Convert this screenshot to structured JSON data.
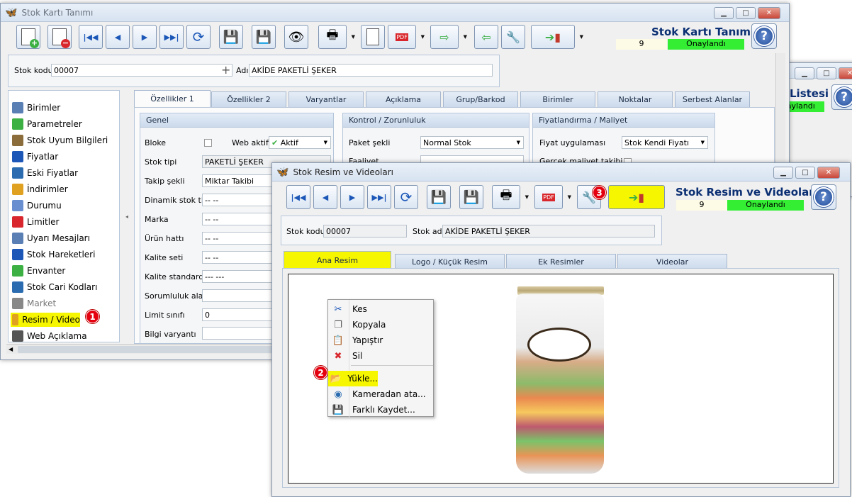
{
  "main_window": {
    "title": "Stok Kartı Tanımı",
    "header_title": "Stok Kartı Tanımı",
    "record_no": "9",
    "status": "Onaylandı",
    "stok_kodu_label": "Stok kodu",
    "stok_kodu": "00007",
    "adi_label": "Adı",
    "adi": "AKİDE PAKETLİ ŞEKER",
    "nav": [
      {
        "label": "Birimler",
        "icon": "units-icon"
      },
      {
        "label": "Parametreler",
        "icon": "parameters-icon"
      },
      {
        "label": "Stok Uyum Bilgileri",
        "icon": "harmony-icon"
      },
      {
        "label": "Fiyatlar",
        "icon": "prices-icon"
      },
      {
        "label": "Eski Fiyatlar",
        "icon": "old-prices-icon"
      },
      {
        "label": "İndirimler",
        "icon": "discount-icon"
      },
      {
        "label": "Durumu",
        "icon": "status-icon"
      },
      {
        "label": "Limitler",
        "icon": "limits-icon"
      },
      {
        "label": "Uyarı Mesajları",
        "icon": "warning-messages-icon"
      },
      {
        "label": "Stok Hareketleri",
        "icon": "stock-movements-icon"
      },
      {
        "label": "Envanter",
        "icon": "inventory-icon"
      },
      {
        "label": "Stok Cari Kodları",
        "icon": "account-codes-icon"
      },
      {
        "label": "Market",
        "icon": "market-icon"
      },
      {
        "label": "Resim / Video",
        "icon": "image-video-icon"
      },
      {
        "label": "Web Açıklama",
        "icon": "web-description-icon"
      }
    ],
    "tabs": [
      "Özellikler 1",
      "Özellikler 2",
      "Varyantlar",
      "Açıklama",
      "Grup/Barkod",
      "Birimler",
      "Noktalar",
      "Serbest Alanlar"
    ],
    "genel": {
      "title": "Genel",
      "bloke": "Bloke",
      "web_aktif": "Web aktif",
      "web_aktif_value": "Aktif",
      "stok_tipi": "Stok tipi",
      "stok_tipi_value": "PAKETLİ ŞEKER",
      "takip_sekli": "Takip şekli",
      "takip_sekli_value": "Miktar Takibi",
      "dinamik": "Dinamik stok tipi",
      "dinamik_value": "-- --",
      "marka": "Marka",
      "marka_value": "-- --",
      "urun_hatti": "Ürün hattı",
      "urun_hatti_value": "-- --",
      "kalite_seti": "Kalite seti",
      "kalite_seti_value": "-- --",
      "kalite_std": "Kalite standardı",
      "kalite_std_value": "--- ---",
      "sorumluluk": "Sorumluluk alanı",
      "limit": "Limit sınıfı",
      "limit_value": "0",
      "bilgi": "Bilgi varyantı"
    },
    "kontrol": {
      "title": "Kontrol / Zorunluluk",
      "paket": "Paket şekli",
      "paket_value": "Normal Stok",
      "faaliyet": "Faaliyet"
    },
    "fiyat": {
      "title": "Fiyatlandırma / Maliyet",
      "uygulama": "Fiyat uygulaması",
      "uygulama_value": "Stok Kendi Fiyatı",
      "gercek": "Gerçek maliyet takibi"
    }
  },
  "bg_window": {
    "title": "Listesi",
    "status": "Onaylandı"
  },
  "image_window": {
    "title": "Stok Resim ve Videoları",
    "header_title": "Stok Resim ve Videoları",
    "record_no": "9",
    "status": "Onaylandı",
    "stok_kodu_label": "Stok kodu",
    "stok_kodu": "00007",
    "stok_adi_label": "Stok adı",
    "stok_adi": "AKİDE PAKETLİ ŞEKER",
    "tabs": [
      "Ana Resim",
      "Logo / Küçük Resim",
      "Ek Resimler",
      "Videolar"
    ],
    "context_menu": [
      {
        "label": "Kes",
        "icon": "scissors-icon"
      },
      {
        "label": "Kopyala",
        "icon": "copy-icon"
      },
      {
        "label": "Yapıştır",
        "icon": "paste-icon"
      },
      {
        "label": "Sil",
        "icon": "delete-icon"
      },
      {
        "label": "Yükle...",
        "icon": "open-folder-icon"
      },
      {
        "label": "Kameradan ata...",
        "icon": "camera-icon"
      },
      {
        "label": "Farklı Kaydet...",
        "icon": "save-as-icon"
      }
    ]
  },
  "badges": [
    "1",
    "2",
    "3"
  ],
  "colors": {
    "status_green": "#33ee33",
    "highlight_yellow": "#f6f600",
    "badge_red": "#e4000f",
    "title_blue": "#0b2f73"
  }
}
